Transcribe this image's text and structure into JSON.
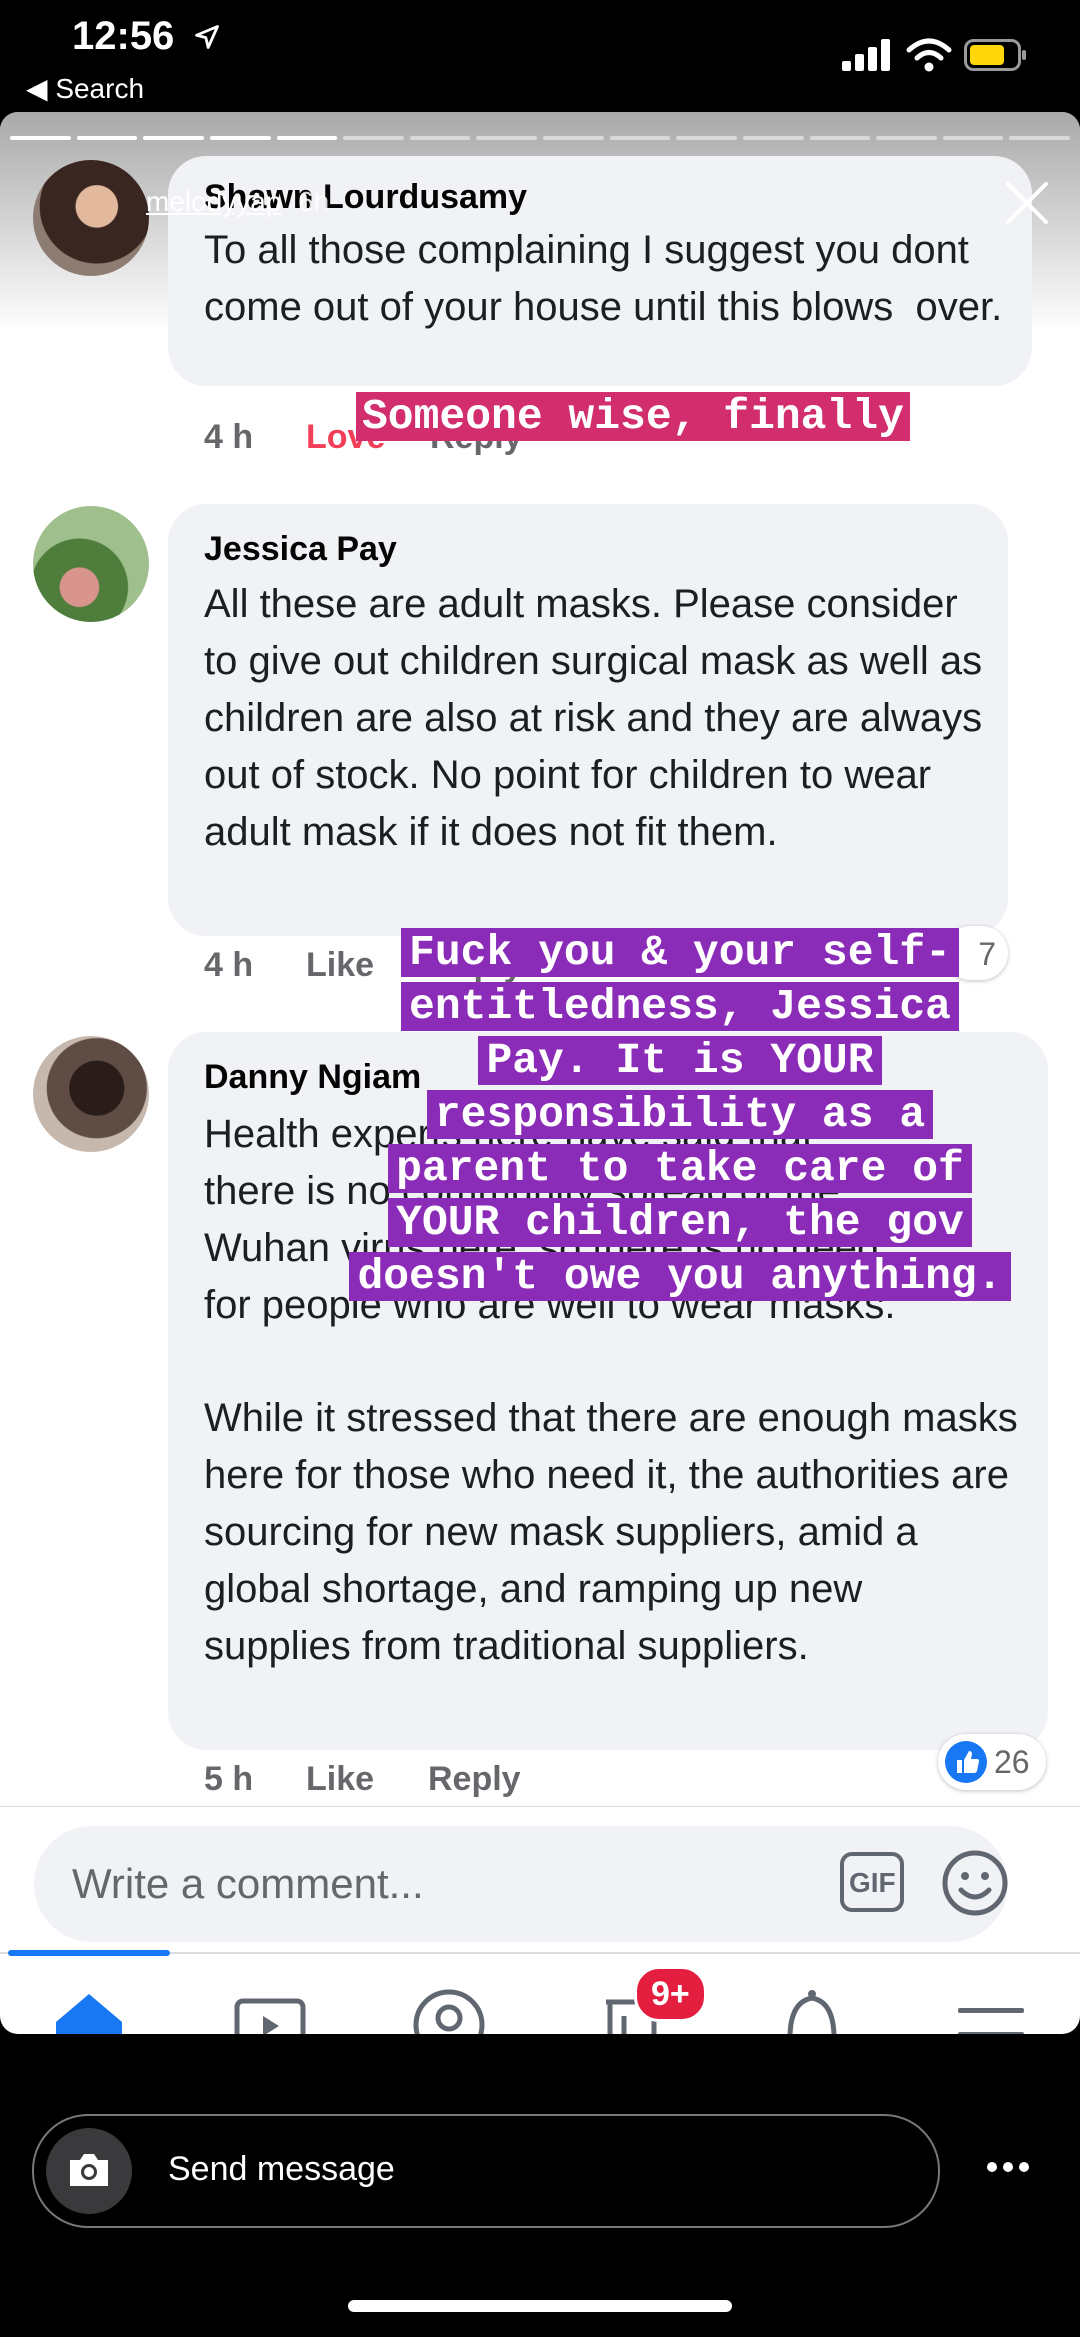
{
  "status": {
    "time": "12:56",
    "back_label": "◀ Search"
  },
  "story": {
    "username": "melodyyap",
    "age": "6h"
  },
  "comments": [
    {
      "name": "Shawn Lourdusamy",
      "text": "To all those complaining I suggest you dont come out of your house until this blows  over.",
      "time": "4 h",
      "action1": "Love",
      "action2": "Reply"
    },
    {
      "name": "Jessica Pay",
      "text": "All these are adult masks. Please consider to give out children surgical mask as well as children are also at risk and they are always out of stock. No point for children to wear adult mask if it does not fit them.",
      "time": "4 h",
      "action1": "Like",
      "action2": "Reply",
      "reactions": "7"
    },
    {
      "name": "Danny Ngiam",
      "text_lines": [
        "Health experts here have said that",
        "there is no community spread of the",
        "Wuhan virus here, so there is no need",
        "for people who are well to wear masks."
      ],
      "text2": "While it stressed that there are enough masks here for those who need it, the authorities are sourcing for new mask suppliers, amid a global shortage, and ramping up new supplies from traditional suppliers.",
      "time": "5 h",
      "action1": "Like",
      "action2": "Reply",
      "reactions": "26"
    }
  ],
  "overlays": {
    "caption1": "Someone wise, finally",
    "caption2_lines": [
      "Fuck you & your self-",
      "entitledness, Jessica",
      "Pay. It is YOUR",
      "responsibility as a",
      "parent to take care of",
      "YOUR children, the gov",
      "doesn't owe you anything."
    ]
  },
  "composer": {
    "placeholder": "Write a comment...",
    "gif_label": "GIF"
  },
  "nav": {
    "badge": "9+"
  },
  "reply_bar": {
    "placeholder": "Send message"
  },
  "icons": [
    "location-arrow-icon",
    "signal-icon",
    "wifi-icon",
    "battery-icon",
    "close-icon",
    "like-icon",
    "gif-icon",
    "emoji-icon",
    "home-icon",
    "video-icon",
    "profile-icon",
    "marketplace-icon",
    "bell-icon",
    "menu-icon",
    "camera-icon",
    "more-icon"
  ],
  "colors": {
    "caption_pink": "#d22d6d",
    "caption_purple": "#8b2cb8",
    "facebook_blue": "#1877f2",
    "love_red": "#f33e58",
    "badge_red": "#e41e3f",
    "battery_yellow": "#ffd60a"
  }
}
